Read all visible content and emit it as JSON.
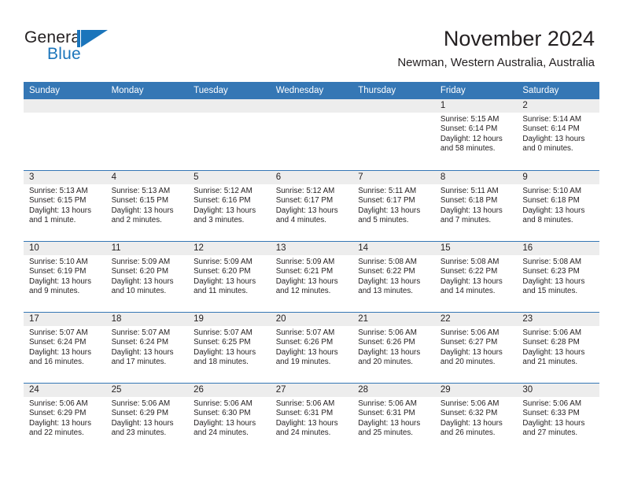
{
  "brand": {
    "name_top": "General",
    "name_bottom": "Blue",
    "mark_icon": "triangle-logo-icon",
    "colors": {
      "blue": "#1b75bb",
      "dark": "#231f20"
    }
  },
  "header": {
    "title": "November 2024",
    "subtitle": "Newman, Western Australia, Australia"
  },
  "theme": {
    "header_blue": "#3577b5",
    "daynum_band": "#ededed",
    "cell_bg": "#ffffff",
    "text": "#231f20"
  },
  "weekdays": [
    {
      "label": "Sunday"
    },
    {
      "label": "Monday"
    },
    {
      "label": "Tuesday"
    },
    {
      "label": "Wednesday"
    },
    {
      "label": "Thursday"
    },
    {
      "label": "Friday"
    },
    {
      "label": "Saturday"
    }
  ],
  "weeks": [
    [
      {
        "day": "",
        "empty": true,
        "sunrise": "",
        "sunset": "",
        "daylight1": "",
        "daylight2": ""
      },
      {
        "day": "",
        "empty": true,
        "sunrise": "",
        "sunset": "",
        "daylight1": "",
        "daylight2": ""
      },
      {
        "day": "",
        "empty": true,
        "sunrise": "",
        "sunset": "",
        "daylight1": "",
        "daylight2": ""
      },
      {
        "day": "",
        "empty": true,
        "sunrise": "",
        "sunset": "",
        "daylight1": "",
        "daylight2": ""
      },
      {
        "day": "",
        "empty": true,
        "sunrise": "",
        "sunset": "",
        "daylight1": "",
        "daylight2": ""
      },
      {
        "day": "1",
        "sunrise": "Sunrise: 5:15 AM",
        "sunset": "Sunset: 6:14 PM",
        "daylight1": "Daylight: 12 hours",
        "daylight2": "and 58 minutes."
      },
      {
        "day": "2",
        "sunrise": "Sunrise: 5:14 AM",
        "sunset": "Sunset: 6:14 PM",
        "daylight1": "Daylight: 13 hours",
        "daylight2": "and 0 minutes."
      }
    ],
    [
      {
        "day": "3",
        "sunrise": "Sunrise: 5:13 AM",
        "sunset": "Sunset: 6:15 PM",
        "daylight1": "Daylight: 13 hours",
        "daylight2": "and 1 minute."
      },
      {
        "day": "4",
        "sunrise": "Sunrise: 5:13 AM",
        "sunset": "Sunset: 6:15 PM",
        "daylight1": "Daylight: 13 hours",
        "daylight2": "and 2 minutes."
      },
      {
        "day": "5",
        "sunrise": "Sunrise: 5:12 AM",
        "sunset": "Sunset: 6:16 PM",
        "daylight1": "Daylight: 13 hours",
        "daylight2": "and 3 minutes."
      },
      {
        "day": "6",
        "sunrise": "Sunrise: 5:12 AM",
        "sunset": "Sunset: 6:17 PM",
        "daylight1": "Daylight: 13 hours",
        "daylight2": "and 4 minutes."
      },
      {
        "day": "7",
        "sunrise": "Sunrise: 5:11 AM",
        "sunset": "Sunset: 6:17 PM",
        "daylight1": "Daylight: 13 hours",
        "daylight2": "and 5 minutes."
      },
      {
        "day": "8",
        "sunrise": "Sunrise: 5:11 AM",
        "sunset": "Sunset: 6:18 PM",
        "daylight1": "Daylight: 13 hours",
        "daylight2": "and 7 minutes."
      },
      {
        "day": "9",
        "sunrise": "Sunrise: 5:10 AM",
        "sunset": "Sunset: 6:18 PM",
        "daylight1": "Daylight: 13 hours",
        "daylight2": "and 8 minutes."
      }
    ],
    [
      {
        "day": "10",
        "sunrise": "Sunrise: 5:10 AM",
        "sunset": "Sunset: 6:19 PM",
        "daylight1": "Daylight: 13 hours",
        "daylight2": "and 9 minutes."
      },
      {
        "day": "11",
        "sunrise": "Sunrise: 5:09 AM",
        "sunset": "Sunset: 6:20 PM",
        "daylight1": "Daylight: 13 hours",
        "daylight2": "and 10 minutes."
      },
      {
        "day": "12",
        "sunrise": "Sunrise: 5:09 AM",
        "sunset": "Sunset: 6:20 PM",
        "daylight1": "Daylight: 13 hours",
        "daylight2": "and 11 minutes."
      },
      {
        "day": "13",
        "sunrise": "Sunrise: 5:09 AM",
        "sunset": "Sunset: 6:21 PM",
        "daylight1": "Daylight: 13 hours",
        "daylight2": "and 12 minutes."
      },
      {
        "day": "14",
        "sunrise": "Sunrise: 5:08 AM",
        "sunset": "Sunset: 6:22 PM",
        "daylight1": "Daylight: 13 hours",
        "daylight2": "and 13 minutes."
      },
      {
        "day": "15",
        "sunrise": "Sunrise: 5:08 AM",
        "sunset": "Sunset: 6:22 PM",
        "daylight1": "Daylight: 13 hours",
        "daylight2": "and 14 minutes."
      },
      {
        "day": "16",
        "sunrise": "Sunrise: 5:08 AM",
        "sunset": "Sunset: 6:23 PM",
        "daylight1": "Daylight: 13 hours",
        "daylight2": "and 15 minutes."
      }
    ],
    [
      {
        "day": "17",
        "sunrise": "Sunrise: 5:07 AM",
        "sunset": "Sunset: 6:24 PM",
        "daylight1": "Daylight: 13 hours",
        "daylight2": "and 16 minutes."
      },
      {
        "day": "18",
        "sunrise": "Sunrise: 5:07 AM",
        "sunset": "Sunset: 6:24 PM",
        "daylight1": "Daylight: 13 hours",
        "daylight2": "and 17 minutes."
      },
      {
        "day": "19",
        "sunrise": "Sunrise: 5:07 AM",
        "sunset": "Sunset: 6:25 PM",
        "daylight1": "Daylight: 13 hours",
        "daylight2": "and 18 minutes."
      },
      {
        "day": "20",
        "sunrise": "Sunrise: 5:07 AM",
        "sunset": "Sunset: 6:26 PM",
        "daylight1": "Daylight: 13 hours",
        "daylight2": "and 19 minutes."
      },
      {
        "day": "21",
        "sunrise": "Sunrise: 5:06 AM",
        "sunset": "Sunset: 6:26 PM",
        "daylight1": "Daylight: 13 hours",
        "daylight2": "and 20 minutes."
      },
      {
        "day": "22",
        "sunrise": "Sunrise: 5:06 AM",
        "sunset": "Sunset: 6:27 PM",
        "daylight1": "Daylight: 13 hours",
        "daylight2": "and 20 minutes."
      },
      {
        "day": "23",
        "sunrise": "Sunrise: 5:06 AM",
        "sunset": "Sunset: 6:28 PM",
        "daylight1": "Daylight: 13 hours",
        "daylight2": "and 21 minutes."
      }
    ],
    [
      {
        "day": "24",
        "sunrise": "Sunrise: 5:06 AM",
        "sunset": "Sunset: 6:29 PM",
        "daylight1": "Daylight: 13 hours",
        "daylight2": "and 22 minutes."
      },
      {
        "day": "25",
        "sunrise": "Sunrise: 5:06 AM",
        "sunset": "Sunset: 6:29 PM",
        "daylight1": "Daylight: 13 hours",
        "daylight2": "and 23 minutes."
      },
      {
        "day": "26",
        "sunrise": "Sunrise: 5:06 AM",
        "sunset": "Sunset: 6:30 PM",
        "daylight1": "Daylight: 13 hours",
        "daylight2": "and 24 minutes."
      },
      {
        "day": "27",
        "sunrise": "Sunrise: 5:06 AM",
        "sunset": "Sunset: 6:31 PM",
        "daylight1": "Daylight: 13 hours",
        "daylight2": "and 24 minutes."
      },
      {
        "day": "28",
        "sunrise": "Sunrise: 5:06 AM",
        "sunset": "Sunset: 6:31 PM",
        "daylight1": "Daylight: 13 hours",
        "daylight2": "and 25 minutes."
      },
      {
        "day": "29",
        "sunrise": "Sunrise: 5:06 AM",
        "sunset": "Sunset: 6:32 PM",
        "daylight1": "Daylight: 13 hours",
        "daylight2": "and 26 minutes."
      },
      {
        "day": "30",
        "sunrise": "Sunrise: 5:06 AM",
        "sunset": "Sunset: 6:33 PM",
        "daylight1": "Daylight: 13 hours",
        "daylight2": "and 27 minutes."
      }
    ]
  ]
}
